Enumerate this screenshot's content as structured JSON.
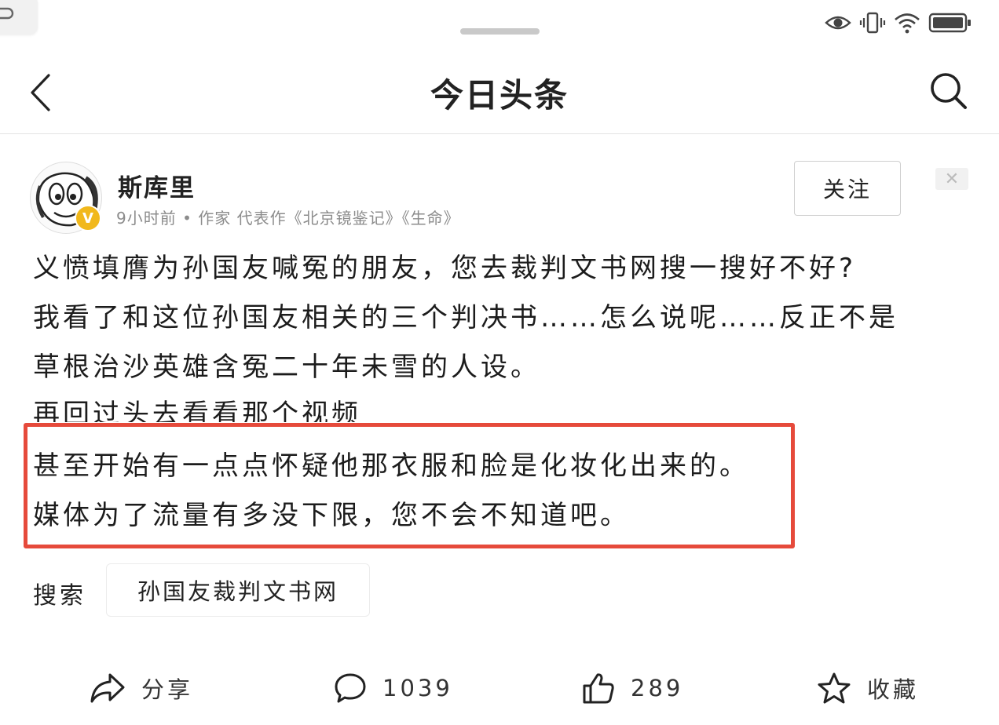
{
  "colors": {
    "highlight_box": "#e64a3b",
    "verified_badge": "#f1b81c",
    "meta_text": "#8c8c8c"
  },
  "icons": [
    "back-chevron",
    "search-magnifier",
    "eye",
    "vibrate",
    "wifi",
    "battery",
    "share-arrow",
    "comment-bubble",
    "thumbs-up",
    "star",
    "close-x"
  ],
  "header": {
    "title": "今日头条"
  },
  "author": {
    "name": "斯库里",
    "verified_badge": "V",
    "meta": "9小时前 • 作家 代表作《北京镜鉴记》《生命》",
    "follow_label": "关注",
    "dismiss_label": "✕"
  },
  "post": {
    "lines": [
      "义愤填膺为孙国友喊冤的朋友，您去裁判文书网搜一搜好不好?",
      "我看了和这位孙国友相关的三个判决书……怎么说呢……反正不是",
      "草根治沙英雄含冤二十年未雪的人设。",
      "再回过头去看看那个视频",
      "甚至开始有一点点怀疑他那衣服和脸是化妆化出来的。",
      "媒体为了流量有多没下限，您不会不知道吧。"
    ]
  },
  "search": {
    "label": "搜索",
    "suggestion": "孙国友裁判文书网"
  },
  "actions": {
    "share": "分享",
    "comments": "1039",
    "likes": "289",
    "favorite": "收藏"
  }
}
